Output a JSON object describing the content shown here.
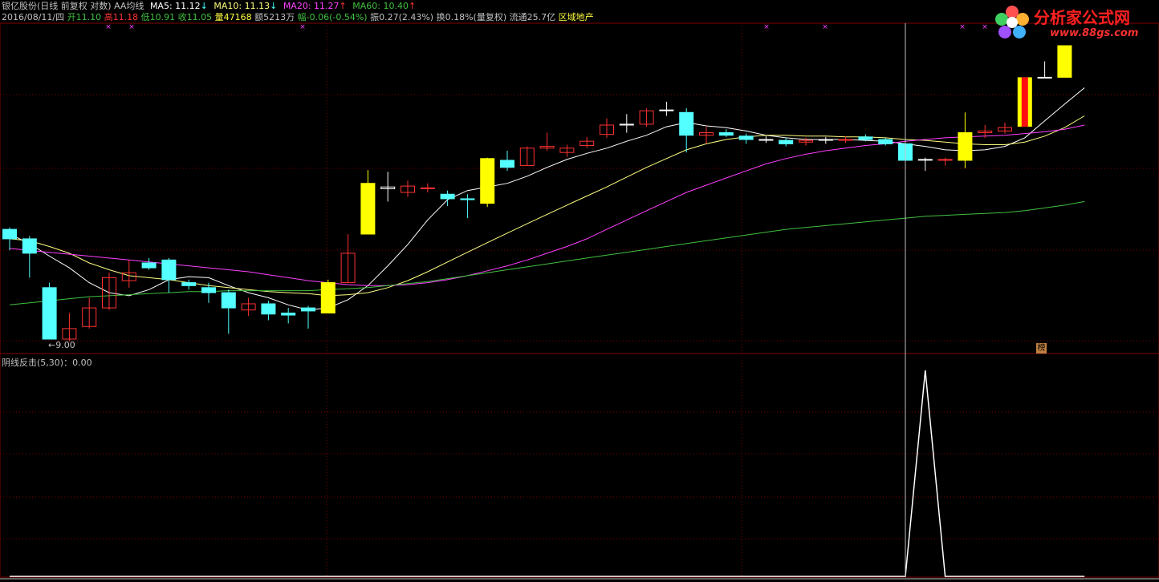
{
  "header": {
    "title": "银亿股份(日线 前复权 对数) AA均线",
    "ma5_label": "MA5: 11.12",
    "ma10_label": "MA10: 11.13",
    "ma20_label": "MA20: 11.27",
    "ma60_label": "MA60: 10.40",
    "arrow_down": "↓",
    "arrow_up": "↑",
    "date": "2016/08/11/四",
    "open_label": "开11.10",
    "high_label": "高11.18",
    "low_label": "低10.91",
    "close_label": "收11.05",
    "volume_label": "量47168",
    "amount_label": "额5213万",
    "change_label": "幅-0.06(-0.54%)",
    "amplitude_label": "振0.27(2.43%)",
    "turnover_label": "换0.18%(量复权)",
    "float_label": "流通25.7亿",
    "sector_label": "区域地产"
  },
  "colors": {
    "ma5": "#ffffff",
    "ma10": "#ffff80",
    "ma20": "#ff40ff",
    "ma60": "#40c040",
    "up": "#ff3232",
    "down": "#54ffff",
    "signal": "#ffff00",
    "grid": "#800000"
  },
  "logo": {
    "text": "分析家公式网",
    "url": "www.88gs.com"
  },
  "price_panel": {
    "low_marker": "←9.00",
    "badge": "榜"
  },
  "indicator": {
    "title": "阴线反击(5,30)：0.00"
  },
  "chart_data": {
    "type": "candlestick",
    "candles": [
      {
        "o": 10.1,
        "c": 10.0,
        "h": 10.12,
        "l": 9.88,
        "kind": "down"
      },
      {
        "o": 10.0,
        "c": 9.85,
        "h": 10.03,
        "l": 9.6,
        "kind": "down"
      },
      {
        "o": 9.5,
        "c": 9.0,
        "h": 9.55,
        "l": 9.0,
        "kind": "down"
      },
      {
        "o": 9.0,
        "c": 9.1,
        "h": 9.25,
        "l": 8.98,
        "kind": "up"
      },
      {
        "o": 9.12,
        "c": 9.3,
        "h": 9.4,
        "l": 9.1,
        "kind": "up"
      },
      {
        "o": 9.3,
        "c": 9.6,
        "h": 9.65,
        "l": 9.28,
        "kind": "up"
      },
      {
        "o": 9.57,
        "c": 9.65,
        "h": 9.78,
        "l": 9.5,
        "kind": "up"
      },
      {
        "o": 9.75,
        "c": 9.7,
        "h": 9.8,
        "l": 9.68,
        "kind": "down"
      },
      {
        "o": 9.78,
        "c": 9.58,
        "h": 9.8,
        "l": 9.45,
        "kind": "down"
      },
      {
        "o": 9.55,
        "c": 9.52,
        "h": 9.58,
        "l": 9.48,
        "kind": "down"
      },
      {
        "o": 9.5,
        "c": 9.45,
        "h": 9.55,
        "l": 9.35,
        "kind": "down"
      },
      {
        "o": 9.45,
        "c": 9.3,
        "h": 9.48,
        "l": 9.05,
        "kind": "down"
      },
      {
        "o": 9.28,
        "c": 9.34,
        "h": 9.4,
        "l": 9.22,
        "kind": "up"
      },
      {
        "o": 9.34,
        "c": 9.24,
        "h": 9.37,
        "l": 9.18,
        "kind": "down"
      },
      {
        "o": 9.25,
        "c": 9.23,
        "h": 9.3,
        "l": 9.15,
        "kind": "down"
      },
      {
        "o": 9.3,
        "c": 9.27,
        "h": 9.32,
        "l": 9.1,
        "kind": "down"
      },
      {
        "o": 9.25,
        "c": 9.55,
        "h": 9.58,
        "l": 9.25,
        "kind": "signal"
      },
      {
        "o": 9.55,
        "c": 9.85,
        "h": 10.05,
        "l": 9.55,
        "kind": "up"
      },
      {
        "o": 10.05,
        "c": 10.6,
        "h": 10.75,
        "l": 10.05,
        "kind": "signal"
      },
      {
        "o": 10.56,
        "c": 10.54,
        "h": 10.73,
        "l": 10.4,
        "kind": "flat"
      },
      {
        "o": 10.5,
        "c": 10.57,
        "h": 10.63,
        "l": 10.45,
        "kind": "up"
      },
      {
        "o": 10.55,
        "c": 10.55,
        "h": 10.6,
        "l": 10.5,
        "kind": "upflat"
      },
      {
        "o": 10.48,
        "c": 10.43,
        "h": 10.52,
        "l": 10.35,
        "kind": "down"
      },
      {
        "o": 10.43,
        "c": 10.42,
        "h": 10.48,
        "l": 10.22,
        "kind": "down"
      },
      {
        "o": 10.38,
        "c": 10.88,
        "h": 10.89,
        "l": 10.34,
        "kind": "signal"
      },
      {
        "o": 10.86,
        "c": 10.78,
        "h": 10.97,
        "l": 10.74,
        "kind": "down"
      },
      {
        "o": 10.8,
        "c": 11.0,
        "h": 11.02,
        "l": 10.8,
        "kind": "up"
      },
      {
        "o": 11.0,
        "c": 11.02,
        "h": 11.18,
        "l": 10.97,
        "kind": "up"
      },
      {
        "o": 10.95,
        "c": 11.0,
        "h": 11.04,
        "l": 10.9,
        "kind": "up"
      },
      {
        "o": 11.03,
        "c": 11.08,
        "h": 11.13,
        "l": 11.0,
        "kind": "up"
      },
      {
        "o": 11.16,
        "c": 11.27,
        "h": 11.35,
        "l": 11.12,
        "kind": "up"
      },
      {
        "o": 11.28,
        "c": 11.27,
        "h": 11.4,
        "l": 11.18,
        "kind": "flat"
      },
      {
        "o": 11.28,
        "c": 11.44,
        "h": 11.47,
        "l": 11.25,
        "kind": "up"
      },
      {
        "o": 11.45,
        "c": 11.45,
        "h": 11.55,
        "l": 11.38,
        "kind": "flat"
      },
      {
        "o": 11.42,
        "c": 11.15,
        "h": 11.47,
        "l": 10.95,
        "kind": "down"
      },
      {
        "o": 11.15,
        "c": 11.18,
        "h": 11.25,
        "l": 11.05,
        "kind": "up"
      },
      {
        "o": 11.18,
        "c": 11.15,
        "h": 11.22,
        "l": 11.13,
        "kind": "down"
      },
      {
        "o": 11.14,
        "c": 11.1,
        "h": 11.17,
        "l": 11.05,
        "kind": "down"
      },
      {
        "o": 11.1,
        "c": 11.1,
        "h": 11.14,
        "l": 11.06,
        "kind": "flat"
      },
      {
        "o": 11.09,
        "c": 11.05,
        "h": 11.12,
        "l": 11.02,
        "kind": "down"
      },
      {
        "o": 11.07,
        "c": 11.09,
        "h": 11.12,
        "l": 11.03,
        "kind": "up"
      },
      {
        "o": 11.1,
        "c": 11.1,
        "h": 11.13,
        "l": 11.05,
        "kind": "flat"
      },
      {
        "o": 11.1,
        "c": 11.1,
        "h": 11.14,
        "l": 11.06,
        "kind": "upflat"
      },
      {
        "o": 11.13,
        "c": 11.1,
        "h": 11.16,
        "l": 11.08,
        "kind": "down"
      },
      {
        "o": 11.1,
        "c": 11.05,
        "h": 11.12,
        "l": 11.03,
        "kind": "down"
      },
      {
        "o": 11.05,
        "c": 10.86,
        "h": 11.08,
        "l": 10.72,
        "kind": "down"
      },
      {
        "o": 10.87,
        "c": 10.87,
        "h": 10.89,
        "l": 10.74,
        "kind": "flat"
      },
      {
        "o": 10.86,
        "c": 10.87,
        "h": 10.89,
        "l": 10.8,
        "kind": "up"
      },
      {
        "o": 10.86,
        "c": 11.18,
        "h": 11.42,
        "l": 10.77,
        "kind": "signal"
      },
      {
        "o": 11.18,
        "c": 11.2,
        "h": 11.27,
        "l": 11.12,
        "kind": "up"
      },
      {
        "o": 11.2,
        "c": 11.24,
        "h": 11.3,
        "l": 11.17,
        "kind": "up"
      },
      {
        "o": 11.25,
        "c": 11.85,
        "h": 11.85,
        "l": 11.25,
        "kind": "limit"
      },
      {
        "o": 11.85,
        "c": 11.85,
        "h": 12.05,
        "l": 11.85,
        "kind": "flat"
      },
      {
        "o": 11.85,
        "c": 12.25,
        "h": 12.25,
        "l": 11.85,
        "kind": "signal"
      }
    ],
    "series": [
      {
        "name": "MA5",
        "values": [
          10.05,
          9.95,
          9.82,
          9.7,
          9.55,
          9.45,
          9.42,
          9.48,
          9.58,
          9.61,
          9.6,
          9.52,
          9.45,
          9.4,
          9.33,
          9.28,
          9.3,
          9.38,
          9.52,
          9.72,
          9.94,
          10.2,
          10.42,
          10.52,
          10.56,
          10.6,
          10.68,
          10.78,
          10.87,
          10.94,
          11.0,
          11.08,
          11.15,
          11.25,
          11.3,
          11.26,
          11.24,
          11.2,
          11.15,
          11.12,
          11.1,
          11.1,
          11.1,
          11.09,
          11.08,
          11.05,
          11.02,
          10.98,
          10.97,
          10.98,
          11.02,
          11.12,
          11.32,
          11.52,
          11.72
        ]
      },
      {
        "name": "MA10",
        "values": [
          10.0,
          9.98,
          9.92,
          9.85,
          9.75,
          9.68,
          9.62,
          9.6,
          9.58,
          9.55,
          9.52,
          9.5,
          9.48,
          9.46,
          9.45,
          9.44,
          9.42,
          9.43,
          9.45,
          9.5,
          9.57,
          9.66,
          9.76,
          9.86,
          9.96,
          10.06,
          10.16,
          10.26,
          10.36,
          10.46,
          10.56,
          10.67,
          10.78,
          10.88,
          10.98,
          11.05,
          11.1,
          11.13,
          11.15,
          11.15,
          11.14,
          11.14,
          11.13,
          11.13,
          11.12,
          11.1,
          11.09,
          11.07,
          11.05,
          11.04,
          11.04,
          11.07,
          11.14,
          11.24,
          11.38
        ]
      },
      {
        "name": "MA20",
        "values": [
          9.9,
          9.88,
          9.86,
          9.84,
          9.82,
          9.8,
          9.78,
          9.76,
          9.74,
          9.72,
          9.7,
          9.68,
          9.66,
          9.63,
          9.6,
          9.57,
          9.55,
          9.53,
          9.52,
          9.52,
          9.53,
          9.55,
          9.58,
          9.62,
          9.67,
          9.72,
          9.78,
          9.85,
          9.92,
          10.0,
          10.1,
          10.2,
          10.3,
          10.4,
          10.5,
          10.58,
          10.66,
          10.74,
          10.82,
          10.88,
          10.93,
          10.97,
          11.0,
          11.03,
          11.05,
          11.08,
          11.1,
          11.12,
          11.13,
          11.14,
          11.15,
          11.17,
          11.19,
          11.22,
          11.27
        ]
      },
      {
        "name": "MA60",
        "values": [
          9.33,
          9.35,
          9.37,
          9.39,
          9.41,
          9.42,
          9.43,
          9.44,
          9.45,
          9.46,
          9.46,
          9.47,
          9.47,
          9.47,
          9.47,
          9.47,
          9.48,
          9.49,
          9.5,
          9.52,
          9.54,
          9.56,
          9.59,
          9.62,
          9.65,
          9.68,
          9.71,
          9.74,
          9.77,
          9.8,
          9.83,
          9.86,
          9.89,
          9.92,
          9.95,
          9.98,
          10.01,
          10.04,
          10.07,
          10.1,
          10.12,
          10.14,
          10.16,
          10.18,
          10.2,
          10.22,
          10.24,
          10.25,
          10.26,
          10.27,
          10.28,
          10.3,
          10.33,
          10.36,
          10.4
        ]
      }
    ],
    "indicator_series": {
      "name": "阴线反击",
      "values": [
        0,
        0,
        0,
        0,
        0,
        0,
        0,
        0,
        0,
        0,
        0,
        0,
        0,
        0,
        0,
        0,
        0,
        0,
        0,
        0,
        0,
        0,
        0,
        0,
        0,
        0,
        0,
        0,
        0,
        0,
        0,
        0,
        0,
        0,
        0,
        0,
        0,
        0,
        0,
        0,
        0,
        0,
        0,
        0,
        0,
        0,
        1,
        0,
        0,
        0,
        0,
        0,
        0,
        0,
        0
      ]
    },
    "cursor_index": 45,
    "price_scale": "log"
  }
}
